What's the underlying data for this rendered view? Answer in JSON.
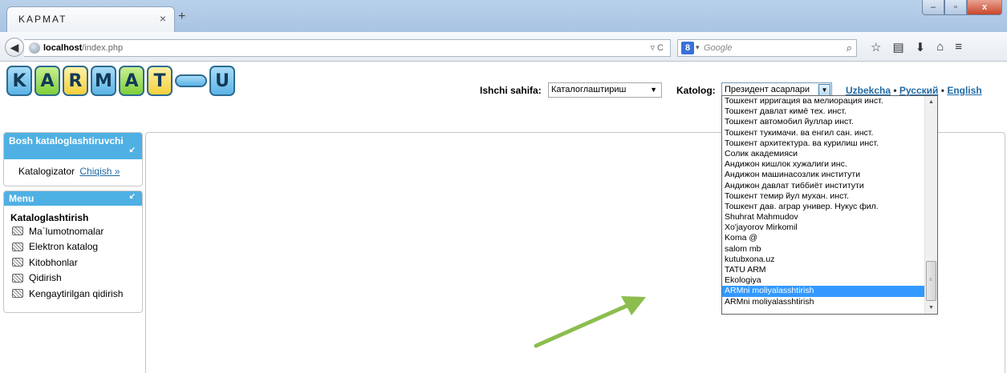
{
  "browser": {
    "tab_title": "KAPMAT",
    "tab_close": "×",
    "new_tab": "+",
    "url_host": "localhost",
    "url_path": "/index.php",
    "url_icons": "▿ C",
    "search_placeholder": "Google",
    "window_buttons": [
      "–",
      "▫",
      "x"
    ]
  },
  "logo": {
    "letters": [
      "K",
      "A",
      "R",
      "M",
      "A",
      "T",
      "U"
    ]
  },
  "header": {
    "workspace_label": "Ishchi sahifa:",
    "workspace_value": "Каталоглаштириш",
    "catalog_label": "Katolog:",
    "catalog_value": "Президент асарлари",
    "languages": [
      "Uzbekcha",
      "Русский",
      "English"
    ],
    "lang_separator": "•"
  },
  "catalog_options": [
    "Тошкент ирригация ва мелиорация инст.",
    "Тошкент давлат кимё тех. инст.",
    "Тошкент автомобил йуллар инст.",
    "Тошкент тукимачи. ва енгил сан. инст.",
    "Тошкент архитектура. ва курилиш инст.",
    "Солик академияси",
    "Андижон кишлок хужалиги инс.",
    "Андижон машинасозлик институти",
    "Андижон давлат тиббиёт институти",
    "Тошкент темир йул мухан. инст.",
    "Тошкент дав. аграр универ. Нукус фил.",
    "Shuhrat Mahmudov",
    "Xo'jayorov Mirkomil",
    "Koma @",
    "salom mb",
    "kutubxona.uz",
    "TATU ARM",
    "Ekologiya",
    "ARMni moliyalasshtirish",
    "ARMni moliyalasshtirish"
  ],
  "catalog_selected_index": 18,
  "sidebar": {
    "panel1_title": "Bosh kataloglashtiruvchi",
    "user_role": "Katalogizator",
    "logout_link": "Chiqish »",
    "menu_title": "Menu",
    "section_title": "Kataloglashtirish",
    "menu_items": [
      "Ma`lumotnomalar",
      "Elektron katalog",
      "Kitobhonlar",
      "Qidirish",
      "Kengaytirilgan qidirish"
    ]
  },
  "colors": {
    "panel_header": "#4fb0e4",
    "selection": "#3399ff",
    "link": "#1f6aa5",
    "arrow": "#8cbd4e"
  }
}
